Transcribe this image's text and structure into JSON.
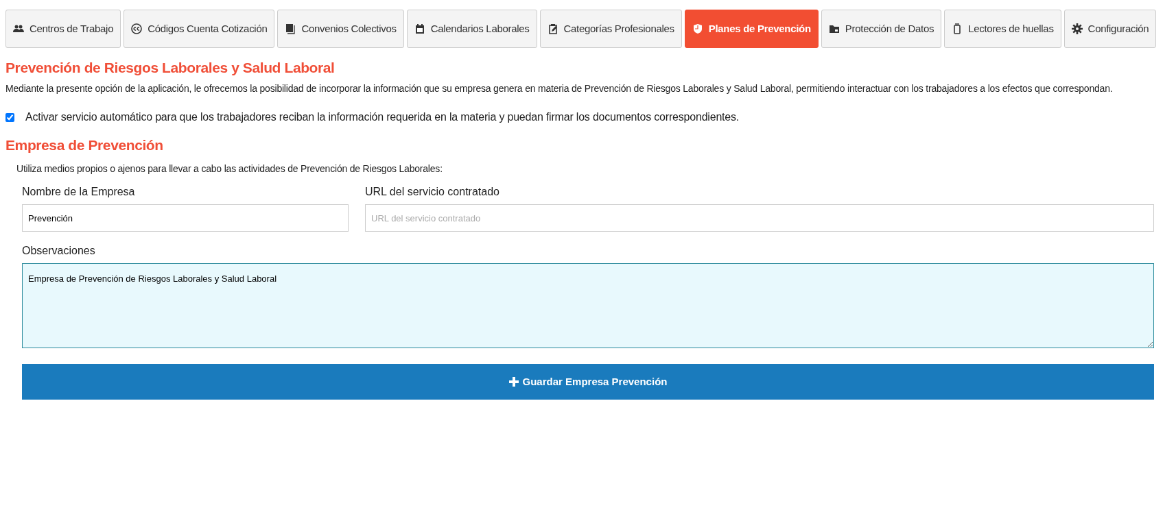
{
  "tabs": [
    {
      "label": "Centros de Trabajo",
      "selected": false
    },
    {
      "label": "Códigos Cuenta Cotización",
      "selected": false
    },
    {
      "label": "Convenios Colectivos",
      "selected": false
    },
    {
      "label": "Calendarios Laborales",
      "selected": false
    },
    {
      "label": "Categorías Profesionales",
      "selected": false
    },
    {
      "label": "Planes de Prevención",
      "selected": true
    },
    {
      "label": "Protección de Datos",
      "selected": false
    },
    {
      "label": "Lectores de huellas",
      "selected": false
    },
    {
      "label": "Configuración",
      "selected": false
    }
  ],
  "title": "Prevención de Riesgos Laborales y Salud Laboral",
  "description": "Mediante la presente opción de la aplicación, le ofrecemos la posibilidad de incorporar la información que su empresa genera en materia de Prevención de Riesgos Laborales y Salud Laboral, permitiendo interactuar con los trabajadores a los efectos que correspondan.",
  "auto_service": {
    "label": "Activar servicio automático para que los trabajadores reciban la información requerida en la materia y puedan firmar los documentos correspondientes.",
    "checked": true
  },
  "section_title": "Empresa de Prevención",
  "section_text": "Utiliza medios propios o ajenos para llevar a cabo las actividades de Prevención de Riesgos Laborales:",
  "fields": [
    {
      "label": "Nombre de la Empresa",
      "value": "Prevención"
    },
    {
      "label": "URL del servicio contratado",
      "placeholder": "URL del servicio contratado"
    }
  ],
  "observations": {
    "label": "Observaciones",
    "value": "Empresa de Prevención de Riesgos Laborales y Salud Laboral"
  },
  "save_button": {
    "label": "Guardar Empresa Prevención"
  }
}
